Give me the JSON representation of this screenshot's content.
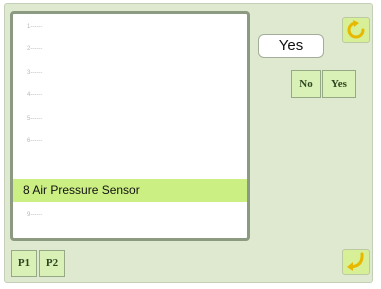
{
  "colors": {
    "panel_bg": "#dfe9d0",
    "selected_row": "#ccef84",
    "button_green": "#d9f0b6",
    "icon_button": "#d7ef96",
    "icon_accent": "#e8b800"
  },
  "list": {
    "items": [
      {
        "label": "1------"
      },
      {
        "label": "2------"
      },
      {
        "label": "3------"
      },
      {
        "label": "4------"
      },
      {
        "label": "5------"
      },
      {
        "label": "6------"
      },
      {
        "label": "8 Air Pressure Sensor",
        "selected": true
      },
      {
        "label": "9------"
      }
    ]
  },
  "pages": {
    "p1_label": "P1",
    "p2_label": "P2"
  },
  "setting": {
    "current_value": "Yes"
  },
  "options": {
    "no_label": "No",
    "yes_label": "Yes"
  },
  "icons": {
    "refresh": "refresh-icon",
    "return": "return-icon"
  }
}
